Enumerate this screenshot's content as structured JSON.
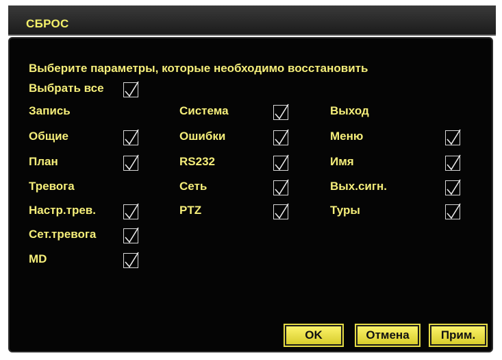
{
  "dialog": {
    "title": "СБРОС",
    "instruction": "Выберите параметры, которые необходимо восстановить",
    "select_all": {
      "label": "Выбрать все",
      "checked": true
    },
    "columns": [
      {
        "header": "Запись",
        "header_checkable": false,
        "items": [
          {
            "label": "Общие",
            "checked": true
          },
          {
            "label": "План",
            "checked": true
          }
        ]
      },
      {
        "header": "Система",
        "header_checkable": true,
        "header_checked": true,
        "items": [
          {
            "label": "Ошибки",
            "checked": true
          },
          {
            "label": "RS232",
            "checked": true
          },
          {
            "label": "Сеть",
            "checked": true
          },
          {
            "label": "PTZ",
            "checked": true
          }
        ]
      },
      {
        "header": "Выход",
        "header_checkable": false,
        "items": [
          {
            "label": "Меню",
            "checked": true
          },
          {
            "label": "Имя",
            "checked": true
          },
          {
            "label": "Вых.сигн.",
            "checked": true
          },
          {
            "label": "Туры",
            "checked": true
          }
        ]
      },
      {
        "header": "Тревога",
        "header_checkable": false,
        "items": [
          {
            "label": "Настр.трев.",
            "checked": true
          },
          {
            "label": "Сет.тревога",
            "checked": true
          },
          {
            "label": "MD",
            "checked": true
          }
        ]
      }
    ],
    "buttons": {
      "ok": "OK",
      "cancel": "Отмена",
      "apply": "Прим."
    }
  },
  "colors": {
    "text": "#f5ee7a",
    "panel_bg": "#050505",
    "button_bg": "#f3ea4a"
  }
}
